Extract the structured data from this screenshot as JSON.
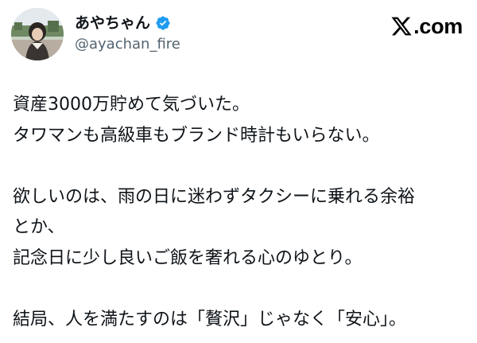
{
  "author": {
    "display_name": "あやちゃん",
    "handle": "@ayachan_fire",
    "verified": true,
    "avatar_icon": "profile-photo"
  },
  "brand": {
    "label": ".com",
    "icon": "x-logo-icon"
  },
  "tweet": {
    "lines": [
      "資産3000万貯めて気づいた。",
      "タワマンも高級車もブランド時計もいらない。",
      "",
      "欲しいのは、雨の日に迷わずタクシーに乗れる余裕",
      "とか、",
      "記念日に少し良いご飯を奢れる心のゆとり。",
      "",
      "結局、人を満たすのは「贅沢」じゃなく「安心」。"
    ]
  },
  "colors": {
    "text_primary": "#0f1419",
    "text_secondary": "#536471",
    "verified_blue": "#1d9bf0",
    "background": "#ffffff"
  }
}
